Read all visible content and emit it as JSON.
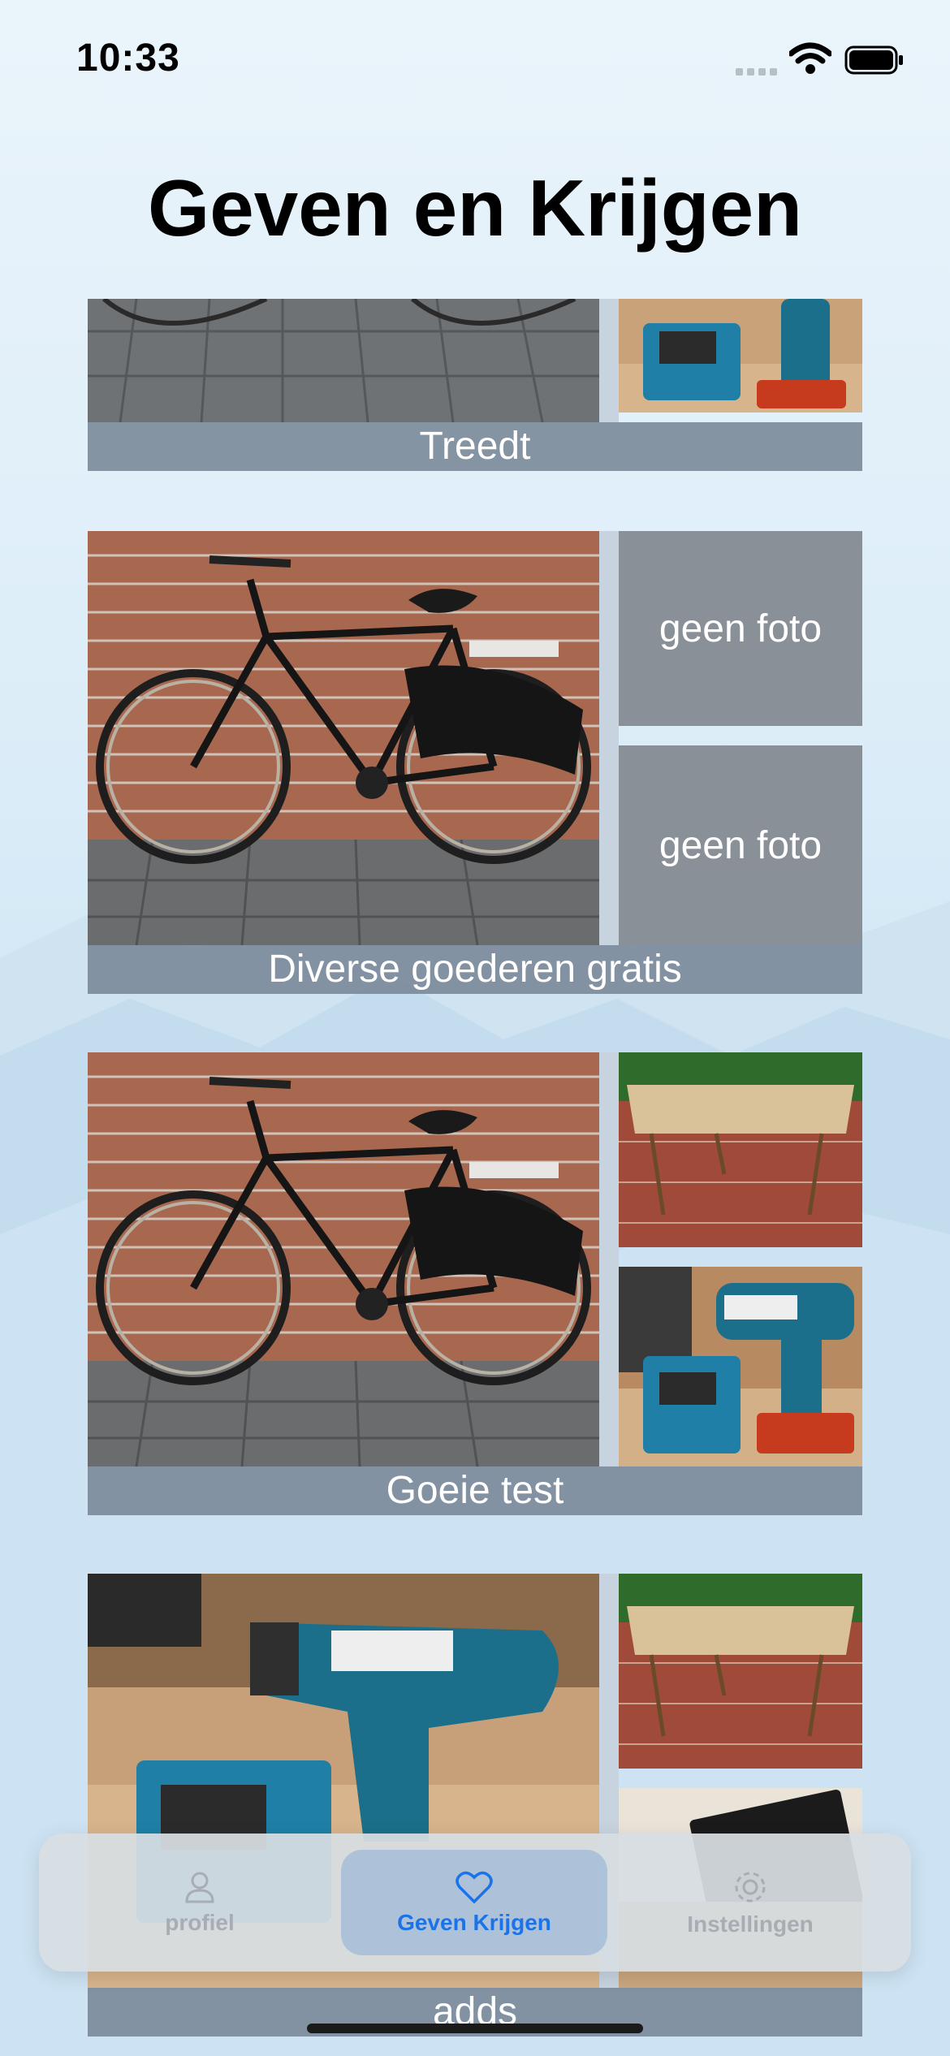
{
  "status_bar": {
    "time": "10:33"
  },
  "page_title": "Geven en Krijgen",
  "cards": [
    {
      "caption": "Treedt",
      "main_photo": "bicycle-photo",
      "side_top": "drill-photo",
      "side_bottom": ""
    },
    {
      "caption": "Diverse goederen gratis",
      "main_photo": "bicycle-photo",
      "side_top_placeholder": "geen foto",
      "side_bottom_placeholder": "geen foto"
    },
    {
      "caption": "Goeie test",
      "main_photo": "bicycle-photo",
      "side_top": "table-photo",
      "side_bottom": "drill-photo"
    },
    {
      "caption": "adds",
      "main_photo": "drill-photo",
      "side_top": "table-photo",
      "side_bottom": "book-photo"
    }
  ],
  "tabbar": {
    "tabs": [
      {
        "label": "profiel",
        "icon": "person-icon",
        "active": false
      },
      {
        "label": "Geven Krijgen",
        "icon": "heart-icon",
        "active": true
      },
      {
        "label": "Instellingen",
        "icon": "gear-icon",
        "active": false
      }
    ]
  },
  "colors": {
    "accent": "#1a73e8",
    "caption_bar": "#788696",
    "placeholder": "#8a9098"
  }
}
